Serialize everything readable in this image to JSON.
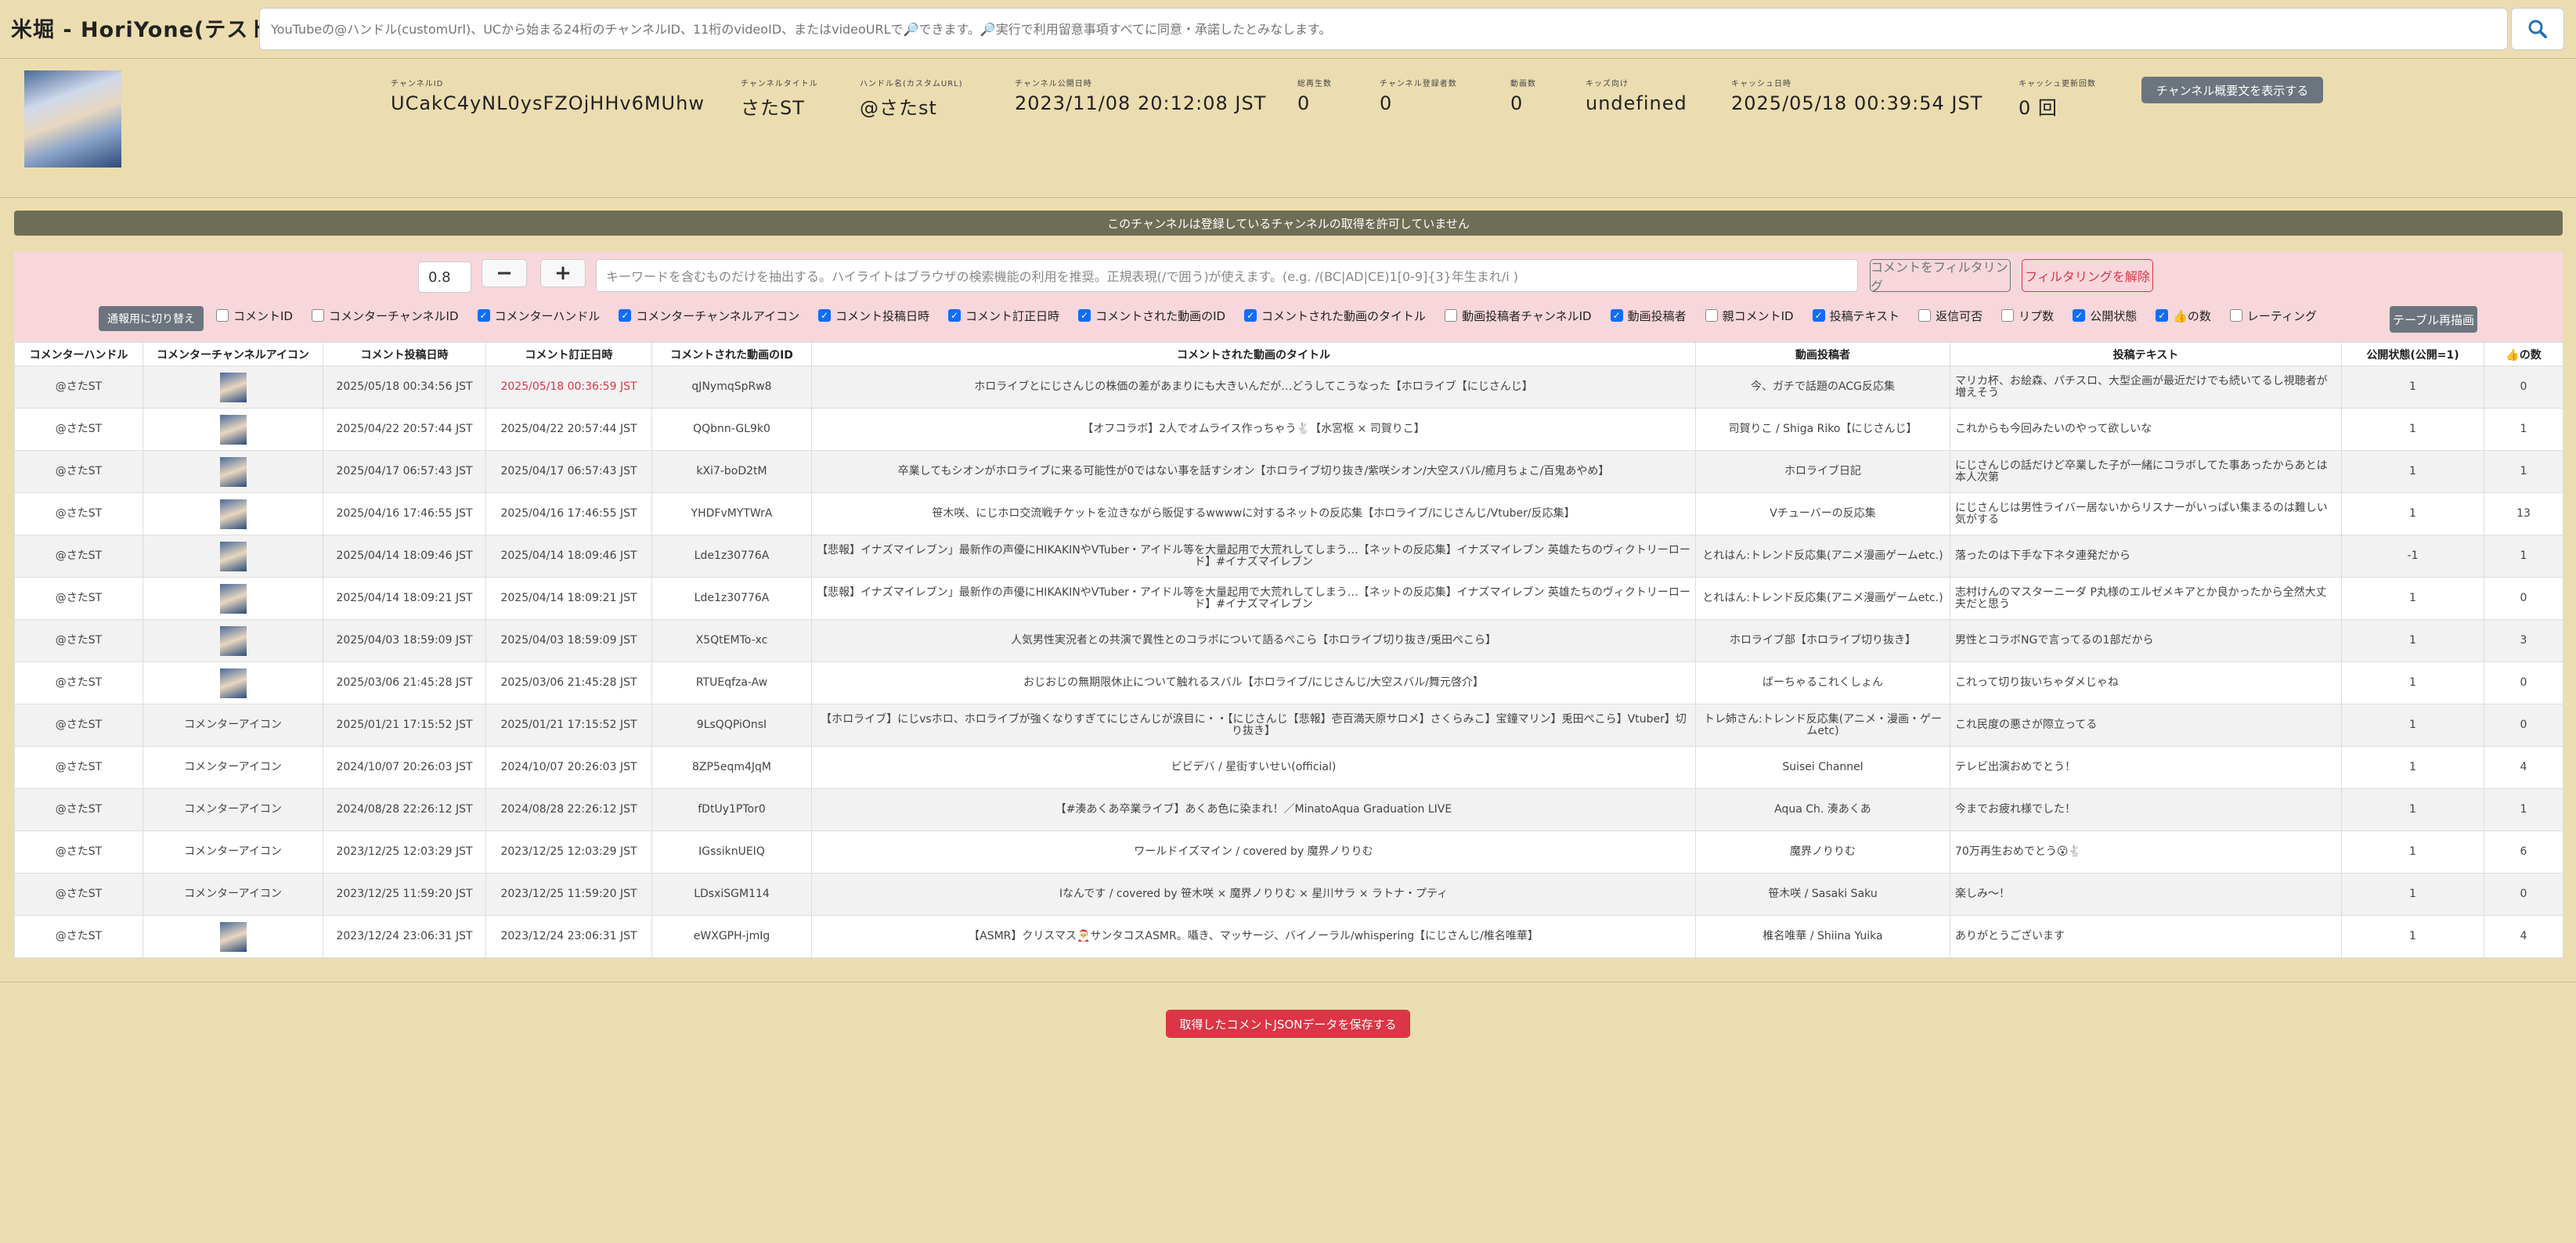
{
  "app": {
    "title": "米堀 - HoriYone(テスト中)"
  },
  "search": {
    "placeholder": "YouTubeの@ハンドル(customUrl)、UCから始まる24桁のチャンネルID、11桁のvideoID、またはvideoURLで🔎できます。🔎実行で利用留意事項すべてに同意・承諾したとみなします。",
    "icon": "search-icon"
  },
  "channel": {
    "fields": [
      {
        "label": "チャンネルID",
        "value": "UCakC4yNL0ysFZOjHHv6MUhw"
      },
      {
        "label": "チャンネルタイトル",
        "value": "さたST"
      },
      {
        "label": "ハンドル名(カスタムURL)",
        "value": "@さたst"
      },
      {
        "label": "チャンネル公開日時",
        "value": "2023/11/08 20:12:08 JST"
      },
      {
        "label": "総再生数",
        "value": "0"
      },
      {
        "label": "チャンネル登録者数",
        "value": "0"
      },
      {
        "label": "動画数",
        "value": "0"
      },
      {
        "label": "キッズ向け",
        "value": "undefined"
      },
      {
        "label": "キャッシュ日時",
        "value": "2025/05/18 00:39:54 JST"
      },
      {
        "label": "キャッシュ更新回数",
        "value": "0 回"
      }
    ],
    "show_desc_button": "チャンネル概要文を表示する"
  },
  "notice": "このチャンネルは登録しているチャンネルの取得を許可していません",
  "filter": {
    "number_value": "0.8",
    "minus_label": "−",
    "plus_label": "+",
    "keyword_placeholder": "キーワードを含むものだけを抽出する。ハイライトはブラウザの検索機能の利用を推奨。正規表現(/で囲う)が使えます。(e.g. /(BC|AD|CE)1[0-9]{3}年生まれ/i )",
    "apply_label": "コメントをフィルタリング",
    "clear_label": "フィルタリングを解除",
    "toggle_label": "通報用に切り替え",
    "redraw_label": "テーブル再描画",
    "checkboxes": [
      {
        "label": "コメントID",
        "checked": false
      },
      {
        "label": "コメンターチャンネルID",
        "checked": false
      },
      {
        "label": "コメンターハンドル",
        "checked": true
      },
      {
        "label": "コメンターチャンネルアイコン",
        "checked": true
      },
      {
        "label": "コメント投稿日時",
        "checked": true
      },
      {
        "label": "コメント訂正日時",
        "checked": true
      },
      {
        "label": "コメントされた動画のID",
        "checked": true
      },
      {
        "label": "コメントされた動画のタイトル",
        "checked": true
      },
      {
        "label": "動画投稿者チャンネルID",
        "checked": false
      },
      {
        "label": "動画投稿者",
        "checked": true
      },
      {
        "label": "親コメントID",
        "checked": false
      },
      {
        "label": "投稿テキスト",
        "checked": true
      },
      {
        "label": "返信可否",
        "checked": false
      },
      {
        "label": "リプ数",
        "checked": false
      },
      {
        "label": "公開状態",
        "checked": true
      },
      {
        "label": "👍の数",
        "checked": true
      },
      {
        "label": "レーティング",
        "checked": false
      }
    ]
  },
  "table": {
    "headers": [
      "コメンターハンドル",
      "コメンターチャンネルアイコン",
      "コメント投稿日時",
      "コメント訂正日時",
      "コメントされた動画のID",
      "コメントされた動画のタイトル",
      "動画投稿者",
      "投稿テキスト",
      "公開状態(公開=1)",
      "👍の数"
    ],
    "icon_alt": "コメンターアイコン",
    "rows": [
      {
        "handle": "@さたST",
        "icon": "image",
        "posted": "2025/05/18 00:34:56 JST",
        "edited": "2025/05/18 00:36:59 JST",
        "edited_red": true,
        "video_id": "qJNymqSpRw8",
        "title": "ホロライブとにじさんじの株価の差があまりにも大きいんだが…どうしてこうなった【ホロライブ【にじさんじ】",
        "uploader": "今、ガチで話題のACG反応集",
        "text": "マリカ杯、お絵森、パチスロ、大型企画が最近だけでも続いてるし視聴者が増えそう",
        "public": "1",
        "likes": "0"
      },
      {
        "handle": "@さたST",
        "icon": "image",
        "posted": "2025/04/22 20:57:44 JST",
        "edited": "2025/04/22 20:57:44 JST",
        "edited_red": false,
        "video_id": "QQbnn-GL9k0",
        "title": "【オフコラボ】2人でオムライス作っちゃう🐇【水宮枢 × 司賀りこ】",
        "uploader": "司賀りこ / Shiga Riko【にじさんじ】",
        "text": "これからも今回みたいのやって欲しいな",
        "public": "1",
        "likes": "1"
      },
      {
        "handle": "@さたST",
        "icon": "image",
        "posted": "2025/04/17 06:57:43 JST",
        "edited": "2025/04/17 06:57:43 JST",
        "edited_red": false,
        "video_id": "kXi7-boD2tM",
        "title": "卒業してもシオンがホロライブに来る可能性が0ではない事を話すシオン【ホロライブ切り抜き/紫咲シオン/大空スバル/癒月ちょこ/百鬼あやめ】",
        "uploader": "ホロライブ日記",
        "text": "にじさんじの話だけど卒業した子が一緒にコラボしてた事あったからあとは本人次第",
        "public": "1",
        "likes": "1"
      },
      {
        "handle": "@さたST",
        "icon": "image",
        "posted": "2025/04/16 17:46:55 JST",
        "edited": "2025/04/16 17:46:55 JST",
        "edited_red": false,
        "video_id": "YHDFvMYTWrA",
        "title": "笹木咲、にじホロ交流戦チケットを泣きながら販促するwwwwに対するネットの反応集【ホロライブ/にじさんじ/Vtuber/反応集】",
        "uploader": "Vチューバーの反応集",
        "text": "にじさんじは男性ライバー居ないからリスナーがいっぱい集まるのは難しい気がする",
        "public": "1",
        "likes": "13"
      },
      {
        "handle": "@さたST",
        "icon": "image",
        "posted": "2025/04/14 18:09:46 JST",
        "edited": "2025/04/14 18:09:46 JST",
        "edited_red": false,
        "video_id": "Lde1z30776A",
        "title": "【悲報】イナズマイレブン」最新作の声優にHIKAKINやVTuber・アイドル等を大量起用で大荒れしてしまう…【ネットの反応集】イナズマイレブン 英雄たちのヴィクトリーロード】#イナズマイレブン",
        "uploader": "とれはん:トレンド反応集(アニメ漫画ゲームetc.)",
        "text": "落ったのは下手な下ネタ連発だから",
        "public": "-1",
        "likes": "1"
      },
      {
        "handle": "@さたST",
        "icon": "image",
        "posted": "2025/04/14 18:09:21 JST",
        "edited": "2025/04/14 18:09:21 JST",
        "edited_red": false,
        "video_id": "Lde1z30776A",
        "title": "【悲報】イナズマイレブン」最新作の声優にHIKAKINやVTuber・アイドル等を大量起用で大荒れしてしまう…【ネットの反応集】イナズマイレブン 英雄たちのヴィクトリーロード】#イナズマイレブン",
        "uploader": "とれはん:トレンド反応集(アニメ漫画ゲームetc.)",
        "text": "志村けんのマスターニーダ P丸様のエルゼメキアとか良かったから全然大丈夫だと思う",
        "public": "1",
        "likes": "0"
      },
      {
        "handle": "@さたST",
        "icon": "image",
        "posted": "2025/04/03 18:59:09 JST",
        "edited": "2025/04/03 18:59:09 JST",
        "edited_red": false,
        "video_id": "X5QtEMTo-xc",
        "title": "人気男性実況者との共演で異性とのコラボについて語るぺこら【ホロライブ切り抜き/兎田ぺこら】",
        "uploader": "ホロライブ部【ホロライブ切り抜き】",
        "text": "男性とコラボNGで言ってるの1部だから",
        "public": "1",
        "likes": "3"
      },
      {
        "handle": "@さたST",
        "icon": "image",
        "posted": "2025/03/06 21:45:28 JST",
        "edited": "2025/03/06 21:45:28 JST",
        "edited_red": false,
        "video_id": "RTUEqfza-Aw",
        "title": "おじおじの無期限休止について触れるスバル【ホロライブ/にじさんじ/大空スバル/舞元啓介】",
        "uploader": "ばーちゃるこれくしょん",
        "text": "これって切り抜いちゃダメじゃね",
        "public": "1",
        "likes": "0"
      },
      {
        "handle": "@さたST",
        "icon": "alt",
        "posted": "2025/01/21 17:15:52 JST",
        "edited": "2025/01/21 17:15:52 JST",
        "edited_red": false,
        "video_id": "9LsQQPiOnsI",
        "title": "【ホロライブ】にじvsホロ、ホロライブが強くなりすぎてにじさんじが涙目に・・【にじさんじ【悲報】壱百満天原サロメ】さくらみこ】宝鐘マリン】兎田ぺこら】Vtuber】切り抜き】",
        "uploader": "トレ姉さん:トレンド反応集(アニメ・漫画・ゲームetc)",
        "text": "これ民度の悪さが際立ってる",
        "public": "1",
        "likes": "0"
      },
      {
        "handle": "@さたST",
        "icon": "alt",
        "posted": "2024/10/07 20:26:03 JST",
        "edited": "2024/10/07 20:26:03 JST",
        "edited_red": false,
        "video_id": "8ZP5eqm4JqM",
        "title": "ビビデバ / 星街すいせい(official)",
        "uploader": "Suisei Channel",
        "text": "テレビ出演おめでとう！",
        "public": "1",
        "likes": "4"
      },
      {
        "handle": "@さたST",
        "icon": "alt",
        "posted": "2024/08/28 22:26:12 JST",
        "edited": "2024/08/28 22:26:12 JST",
        "edited_red": false,
        "video_id": "fDtUy1PTor0",
        "title": "【#湊あくあ卒業ライブ】あくあ色に染まれ！／MinatoAqua Graduation LIVE",
        "uploader": "Aqua Ch. 湊あくあ",
        "text": "今までお疲れ様でした！",
        "public": "1",
        "likes": "1"
      },
      {
        "handle": "@さたST",
        "icon": "alt",
        "posted": "2023/12/25 12:03:29 JST",
        "edited": "2023/12/25 12:03:29 JST",
        "edited_red": false,
        "video_id": "IGssiknUEIQ",
        "title": "ワールドイズマイン / covered by 魔界ノりりむ",
        "uploader": "魔界ノりりむ",
        "text": "70万再生おめでとう😮🐇",
        "public": "1",
        "likes": "6"
      },
      {
        "handle": "@さたST",
        "icon": "alt",
        "posted": "2023/12/25 11:59:20 JST",
        "edited": "2023/12/25 11:59:20 JST",
        "edited_red": false,
        "video_id": "LDsxiSGM114",
        "title": "Iなんです / covered by 笹木咲 × 魔界ノりりむ × 星川サラ × ラトナ・プティ",
        "uploader": "笹木咲 / Sasaki Saku",
        "text": "楽しみ～！",
        "public": "1",
        "likes": "0"
      },
      {
        "handle": "@さたST",
        "icon": "image",
        "posted": "2023/12/24 23:06:31 JST",
        "edited": "2023/12/24 23:06:31 JST",
        "edited_red": false,
        "video_id": "eWXGPH-jmIg",
        "title": "【ASMR】クリスマス🎅サンタコスASMR。囁き、マッサージ、バイノーラル/whispering【にじさんじ/椎名唯華】",
        "uploader": "椎名唯華 / Shiina Yuika",
        "text": "ありがとうございます",
        "public": "1",
        "likes": "4"
      }
    ]
  },
  "save_button": "取得したコメントJSONデータを保存する"
}
